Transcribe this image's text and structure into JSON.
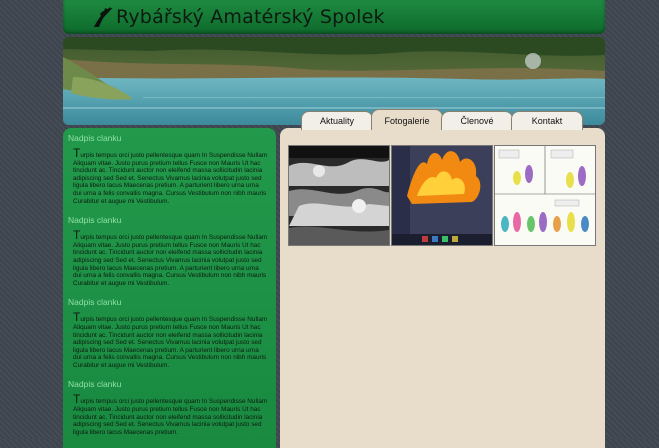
{
  "site": {
    "title": "Rybářský Amatérský Spolek",
    "logo_icon": "fisherman-logo-icon"
  },
  "nav": {
    "tabs": [
      {
        "label": "Aktuality"
      },
      {
        "label": "Fotogalerie",
        "active": true
      },
      {
        "label": "Členové"
      },
      {
        "label": "Kontakt"
      }
    ]
  },
  "articles": [
    {
      "title": "Nadpis clanku",
      "dropcap": "T",
      "body": "urpis tempus orci justo pellentesque quam In Suspendisse Nullam Aliquam vitae. Justo purus pretium tellus Fusce non Mauris Ut hac tincidunt ac. Tincidunt auctor non eleifend massa sollicitudin lacinia adipiscing sed Sed et. Senectus Vivamus lacinia volutpat justo sed ligula libero lacus Maecenas pretium. A parturient libero urna urna dui urna a felis convallis magna. Cursus Vestibulum non nibh mauris Curabitur et augue mi Vestibulum."
    },
    {
      "title": "Nadpis clanku",
      "dropcap": "T",
      "body": "urpis tempus orci justo pellentesque quam In Suspendisse Nullam Aliquam vitae. Justo purus pretium tellus Fusce non Mauris Ut hac tincidunt ac. Tincidunt auctor non eleifend massa sollicitudin lacinia adipiscing sed Sed et. Senectus Vivamus lacinia volutpat justo sed ligula libero lacus Maecenas pretium. A parturient libero urna urna dui urna a felis convallis magna. Cursus Vestibulum non nibh mauris Curabitur et augue mi Vestibulum."
    },
    {
      "title": "Nadpis clanku",
      "dropcap": "T",
      "body": "urpis tempus orci justo pellentesque quam In Suspendisse Nullam Aliquam vitae. Justo purus pretium tellus Fusce non Mauris Ut hac tincidunt ac. Tincidunt auctor non eleifend massa sollicitudin lacinia adipiscing sed Sed et. Senectus Vivamus lacinia volutpat justo sed ligula libero lacus Maecenas pretium. A parturient libero urna urna dui urna a felis convallis magna. Cursus Vestibulum non nibh mauris Curabitur et augue mi Vestibulum."
    },
    {
      "title": "Nadpis clanku",
      "dropcap": "T",
      "body": "urpis tempus orci justo pellentesque quam In Suspendisse Nullam Aliquam vitae. Justo purus pretium tellus Fusce non Mauris Ut hac tincidunt ac. Tincidunt auctor non eleifend massa sollicitudin lacinia adipiscing sed Sed et. Senectus Vivamus lacinia volutpat justo sed ligula libero lacus Maecenas pretium."
    }
  ],
  "gallery": {
    "thumbnails": [
      {
        "subject": "black-and-white cloud/smoke photo"
      },
      {
        "subject": "game screenshot with fire"
      },
      {
        "subject": "comic strip"
      }
    ]
  },
  "colors": {
    "header_green": "#1e8a40",
    "sidebar_green": "#1f9447",
    "content_beige": "#e8dccb",
    "background": "#3f4650"
  }
}
